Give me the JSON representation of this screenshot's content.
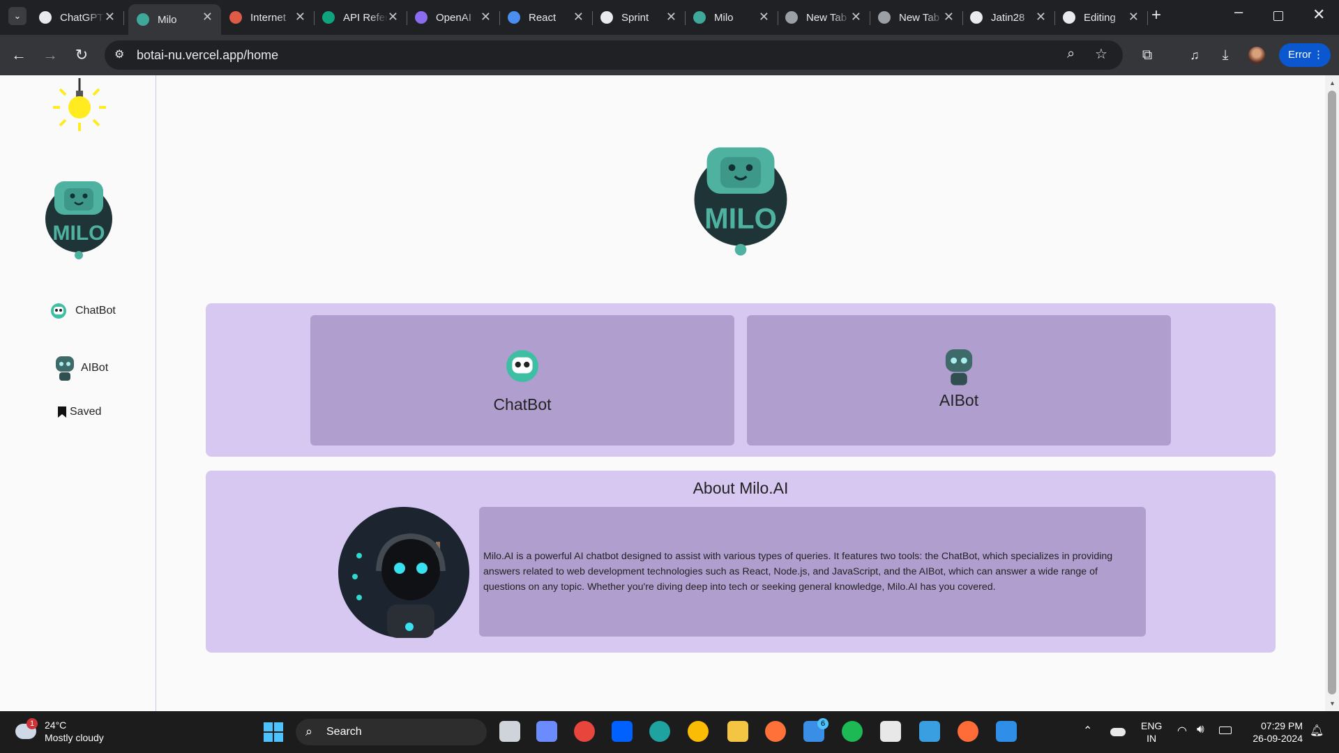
{
  "browser": {
    "tabs": [
      {
        "label": "ChatGPT",
        "color": "#e8eaed"
      },
      {
        "label": "Milo",
        "color": "#3fa89a",
        "active": true
      },
      {
        "label": "Internet",
        "color": "#e05a47"
      },
      {
        "label": "API Reference",
        "color": "#10a37f"
      },
      {
        "label": "OpenAI",
        "color": "#8b6cf0"
      },
      {
        "label": "React",
        "color": "#4a8ef0"
      },
      {
        "label": "Sprint",
        "color": "#e8eaed"
      },
      {
        "label": "Milo",
        "color": "#3fa89a"
      },
      {
        "label": "New Tab",
        "color": "#9aa0a6"
      },
      {
        "label": "New Tab",
        "color": "#9aa0a6"
      },
      {
        "label": "Jatin28",
        "color": "#e8eaed"
      },
      {
        "label": "Editing",
        "color": "#e8eaed"
      }
    ],
    "url": "botai-nu.vercel.app/home",
    "error_label": "Error"
  },
  "sidebar": {
    "items": [
      {
        "label": "ChatBot"
      },
      {
        "label": "AIBot"
      },
      {
        "label": "Saved"
      }
    ]
  },
  "main": {
    "logo_text": "MILO",
    "cards": [
      {
        "label": "ChatBot"
      },
      {
        "label": "AIBot"
      }
    ],
    "about": {
      "title": "About Milo.AI",
      "text": "Milo.AI is a powerful AI chatbot designed to assist with various types of queries. It features two tools: the ChatBot, which specializes in providing answers related to web development technologies such as React, Node.js, and JavaScript, and the AIBot, which can answer a wide range of questions on any topic. Whether you're diving deep into tech or seeking general knowledge, Milo.AI has you covered."
    }
  },
  "taskbar": {
    "weather": {
      "temp": "24°C",
      "desc": "Mostly cloudy",
      "badge": "1"
    },
    "search_label": "Search",
    "mail_badge": "6",
    "lang": "ENG",
    "region": "IN",
    "time": "07:29 PM",
    "date": "26-09-2024"
  }
}
